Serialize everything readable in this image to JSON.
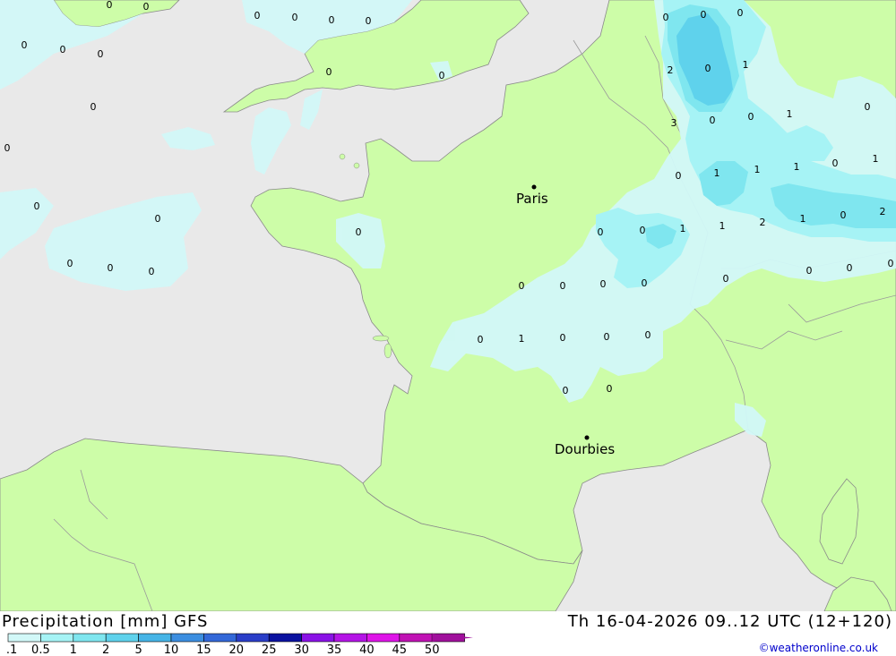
{
  "map": {
    "colors": {
      "sea": "#e9e9e9",
      "land": "#cdfda8",
      "border": "#9a9a9a",
      "coast": "#8a8a8a",
      "precip_01": "#d2f8f8",
      "precip_05": "#a6f3f5",
      "precip_1": "#7fe6ef",
      "precip_2": "#5fd2ec"
    },
    "cities": [
      {
        "name": "Paris"
      },
      {
        "name": "Dourbies"
      }
    ],
    "isoline_labels": [
      "0",
      "0",
      "0",
      "0",
      "0",
      "0",
      "0",
      "0",
      "0",
      "0",
      "0",
      "0",
      "0",
      "0",
      "0",
      "0",
      "0",
      "0",
      "0",
      "0",
      "0",
      "0",
      "2",
      "0",
      "1",
      "3",
      "0",
      "0",
      "1",
      "0",
      "0",
      "1",
      "1",
      "1",
      "0",
      "1",
      "0",
      "2",
      "1",
      "2",
      "1",
      "0",
      "1",
      "0",
      "0",
      "0",
      "0",
      "0",
      "0",
      "0",
      "0",
      "0",
      "0",
      "1",
      "0",
      "0",
      "0",
      "0",
      "0",
      "0",
      "0",
      "0",
      "0",
      "0",
      "0",
      "0",
      "0",
      "0"
    ]
  },
  "footer": {
    "title": "Precipitation [mm] GFS",
    "timestamp": "Th 16-04-2026 09..12 UTC (12+120)",
    "credit": "©weatheronline.co.uk"
  },
  "legend": {
    "ticks": [
      "0.1",
      "0.5",
      "1",
      "2",
      "5",
      "10",
      "15",
      "20",
      "25",
      "30",
      "35",
      "40",
      "45",
      "50"
    ],
    "colors": [
      "#d2f8f8",
      "#a6f3f5",
      "#7fe6ef",
      "#5fd2ec",
      "#46b4e6",
      "#3c8ee0",
      "#3368d8",
      "#2a3ec8",
      "#0a12a0",
      "#8a12e6",
      "#b414e6",
      "#de14e8",
      "#c012b4",
      "#a0109c"
    ]
  }
}
